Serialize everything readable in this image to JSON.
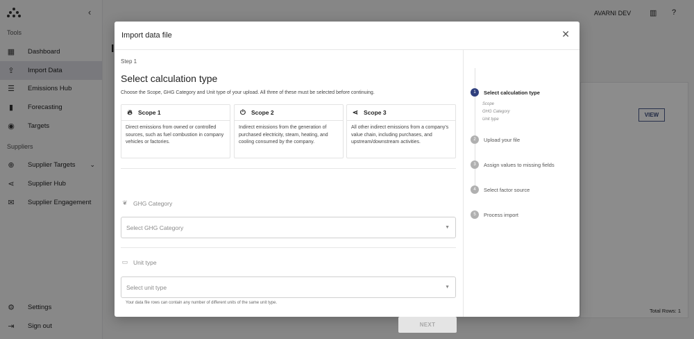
{
  "sidebar": {
    "tools_label": "Tools",
    "suppliers_label": "Suppliers",
    "items": [
      {
        "label": "Dashboard",
        "icon": "dashboard-icon"
      },
      {
        "label": "Import Data",
        "icon": "upload-icon"
      },
      {
        "label": "Emissions Hub",
        "icon": "list-icon"
      },
      {
        "label": "Forecasting",
        "icon": "bar-chart-icon"
      },
      {
        "label": "Targets",
        "icon": "target-icon"
      },
      {
        "label": "Supplier Targets",
        "icon": "crosshair-icon"
      },
      {
        "label": "Supplier Hub",
        "icon": "share-icon"
      },
      {
        "label": "Supplier Engagement",
        "icon": "mail-icon"
      },
      {
        "label": "Settings",
        "icon": "gear-icon"
      },
      {
        "label": "Sign out",
        "icon": "sign-out-icon"
      }
    ]
  },
  "topbar": {
    "user": "AVARNI DEV"
  },
  "background": {
    "page_title": "I",
    "view_label": "VIEW",
    "total_rows": "Total Rows: 1"
  },
  "modal": {
    "title": "Import data file",
    "step": "Step 1",
    "heading": "Select calculation type",
    "instructions": "Choose the Scope, GHG Category and Unit type of your upload. All three of these must be selected before continuing.",
    "scopes": [
      {
        "title": "Scope 1",
        "icon": "flame-icon",
        "desc": "Direct emissions from owned or controlled sources, such as fuel combustion in company vehicles or factories."
      },
      {
        "title": "Scope 2",
        "icon": "plug-icon",
        "desc": "Indirect emissions from the generation of purchased electricity, steam, heating, and cooling consumed by the company."
      },
      {
        "title": "Scope 3",
        "icon": "share-icon",
        "desc": "All other indirect emissions from a company's value chain, including purchases, and upstream/downstream activities."
      }
    ],
    "ghg_label": "GHG Category",
    "ghg_placeholder": "Select GHG Category",
    "unit_label": "Unit type",
    "unit_placeholder": "Select unit type",
    "unit_helper": "Your data file rows can contain any number of different units of the same unit type.",
    "next_label": "NEXT"
  },
  "stepper": {
    "steps": [
      {
        "num": "1",
        "label": "Select calculation type",
        "active": true
      },
      {
        "num": "2",
        "label": "Upload your file"
      },
      {
        "num": "3",
        "label": "Assign values to missing fields"
      },
      {
        "num": "4",
        "label": "Select factor source"
      },
      {
        "num": "5",
        "label": "Process import"
      }
    ],
    "substeps": [
      "Scope",
      "GHG Category",
      "Unit type"
    ]
  },
  "colors": {
    "accent": "#2f3f7d",
    "overlay": "rgba(0,0,0,0.45)"
  }
}
